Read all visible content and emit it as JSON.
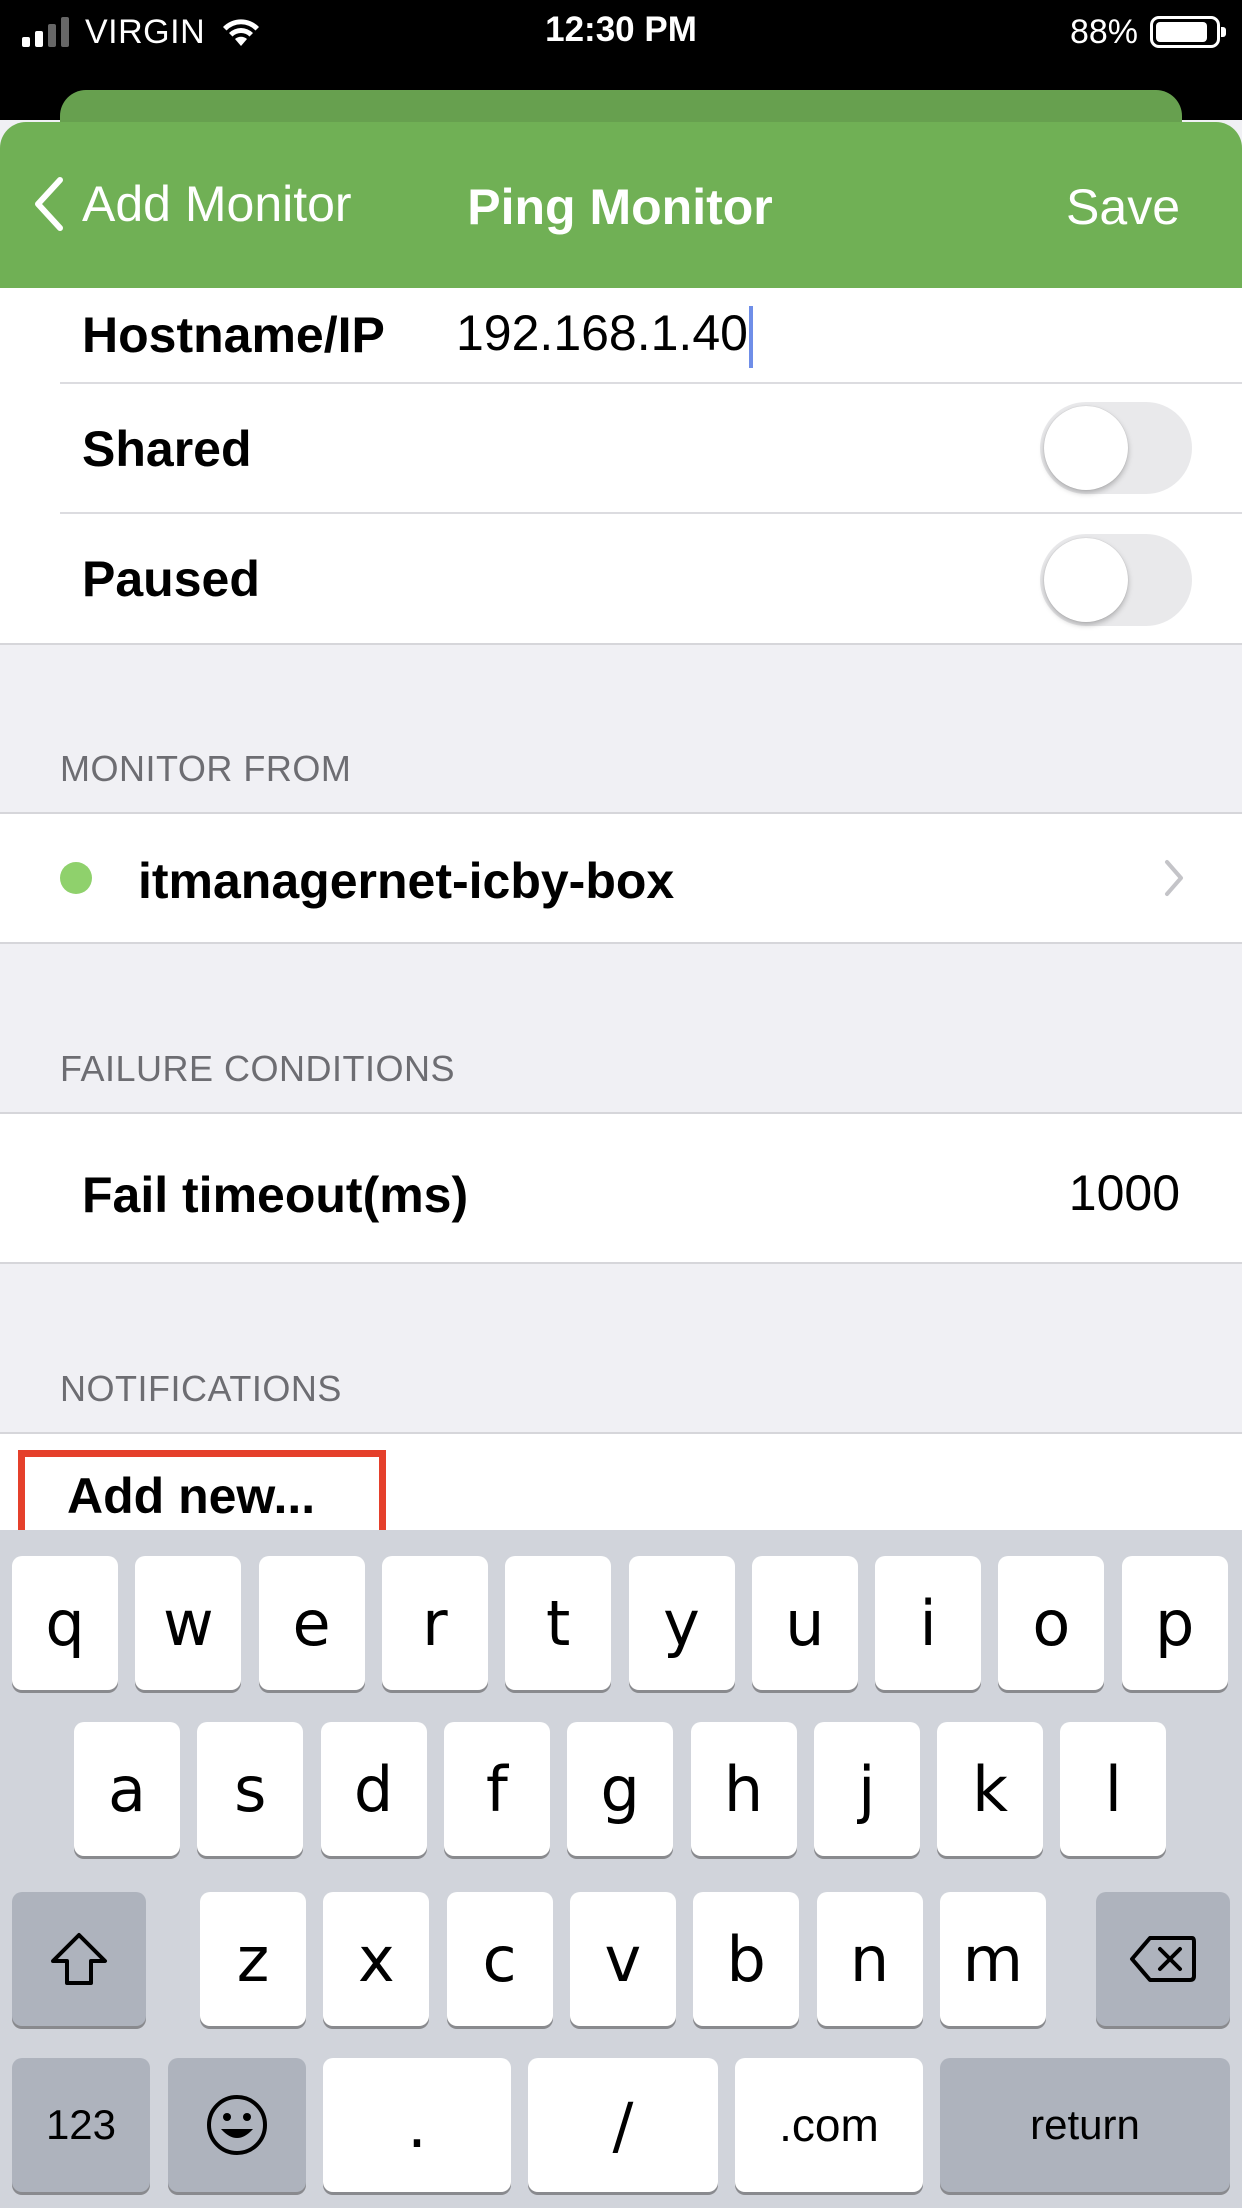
{
  "status_bar": {
    "carrier": "VIRGIN",
    "time": "12:30 PM",
    "battery_percent": "88%",
    "battery_level": 0.88,
    "icons": [
      "signal-icon",
      "wifi-icon",
      "battery-icon"
    ]
  },
  "nav": {
    "back_label": "Add Monitor",
    "title": "Ping Monitor",
    "save_label": "Save",
    "color": "#70b055"
  },
  "form": {
    "hostname_label": "Hostname/IP",
    "hostname_value": "192.168.1.40",
    "shared_label": "Shared",
    "shared_on": false,
    "paused_label": "Paused",
    "paused_on": false
  },
  "monitor_from": {
    "header": "MONITOR FROM",
    "agent_name": "itmanagernet-icby-box",
    "agent_status_color": "#8fd16c"
  },
  "failure_conditions": {
    "header": "FAILURE CONDITIONS",
    "fail_timeout_label": "Fail timeout(ms)",
    "fail_timeout_value": "1000"
  },
  "notifications": {
    "header": "NOTIFICATIONS",
    "add_new_label": "Add new..."
  },
  "keyboard": {
    "row1": [
      "q",
      "w",
      "e",
      "r",
      "t",
      "y",
      "u",
      "i",
      "o",
      "p"
    ],
    "row2": [
      "a",
      "s",
      "d",
      "f",
      "g",
      "h",
      "j",
      "k",
      "l"
    ],
    "row3": [
      "z",
      "x",
      "c",
      "v",
      "b",
      "n",
      "m"
    ],
    "numbers_key": "123",
    "period_key": ".",
    "slash_key": "/",
    "dotcom_key": ".com",
    "return_key": "return",
    "icons": [
      "shift-icon",
      "backspace-icon",
      "emoji-icon"
    ]
  }
}
